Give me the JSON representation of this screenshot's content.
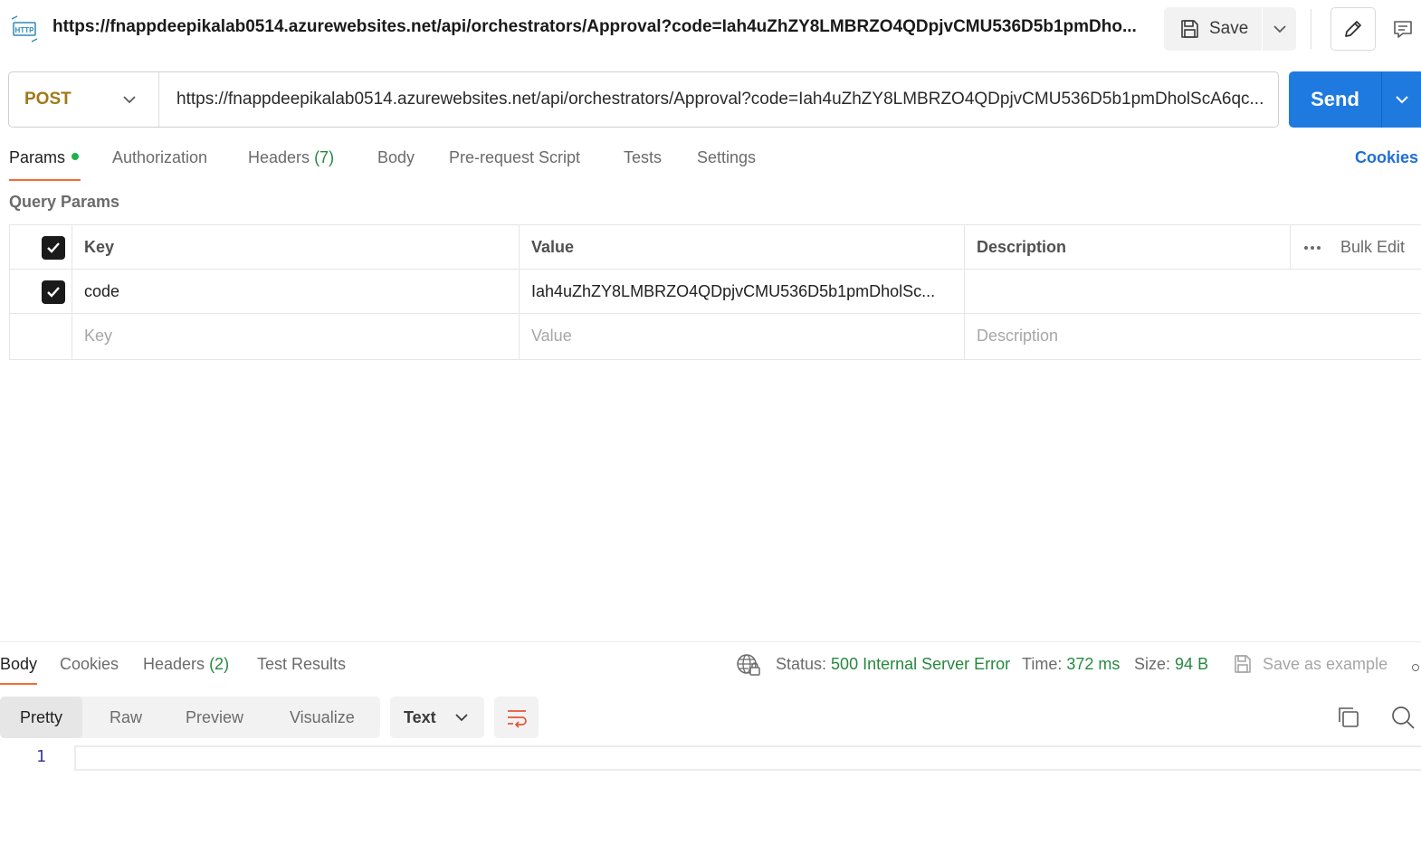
{
  "header": {
    "request_title": "https://fnappdeepikalab0514.azurewebsites.net/api/orchestrators/Approval?code=Iah4uZhZY8LMBRZO4QDpjvCMU536D5b1pmDho...",
    "save_label": "Save",
    "http_icon_label": "HTTP"
  },
  "request": {
    "method": "POST",
    "url": "https://fnappdeepikalab0514.azurewebsites.net/api/orchestrators/Approval?code=Iah4uZhZY8LMBRZO4QDpjvCMU536D5b1pmDholScA6qc...",
    "send_label": "Send"
  },
  "request_tabs": {
    "params": "Params",
    "authorization": "Authorization",
    "headers": "Headers",
    "headers_count": "(7)",
    "body": "Body",
    "pre_request": "Pre-request Script",
    "tests": "Tests",
    "settings": "Settings",
    "cookies": "Cookies"
  },
  "query_params": {
    "title": "Query Params",
    "columns": {
      "key": "Key",
      "value": "Value",
      "description": "Description"
    },
    "bulk_edit": "Bulk Edit",
    "rows": [
      {
        "key": "code",
        "value": "Iah4uZhZY8LMBRZO4QDpjvCMU536D5b1pmDholSc...",
        "description": "",
        "checked": true
      }
    ],
    "placeholders": {
      "key": "Key",
      "value": "Value",
      "description": "Description"
    }
  },
  "response": {
    "tabs": {
      "body": "Body",
      "cookies": "Cookies",
      "headers": "Headers",
      "headers_count": "(2)",
      "test_results": "Test Results"
    },
    "status_label": "Status:",
    "status_value": "500 Internal Server Error",
    "time_label": "Time:",
    "time_value": "372 ms",
    "size_label": "Size:",
    "size_value": "94 B",
    "save_example": "Save as example",
    "views": {
      "pretty": "Pretty",
      "raw": "Raw",
      "preview": "Preview",
      "visualize": "Visualize"
    },
    "format": "Text",
    "line_number": "1"
  },
  "colors": {
    "accent_blue": "#1f7ae0",
    "method_post": "#a3781a",
    "success_green": "#26883f",
    "tab_underline": "#f26b3a"
  }
}
